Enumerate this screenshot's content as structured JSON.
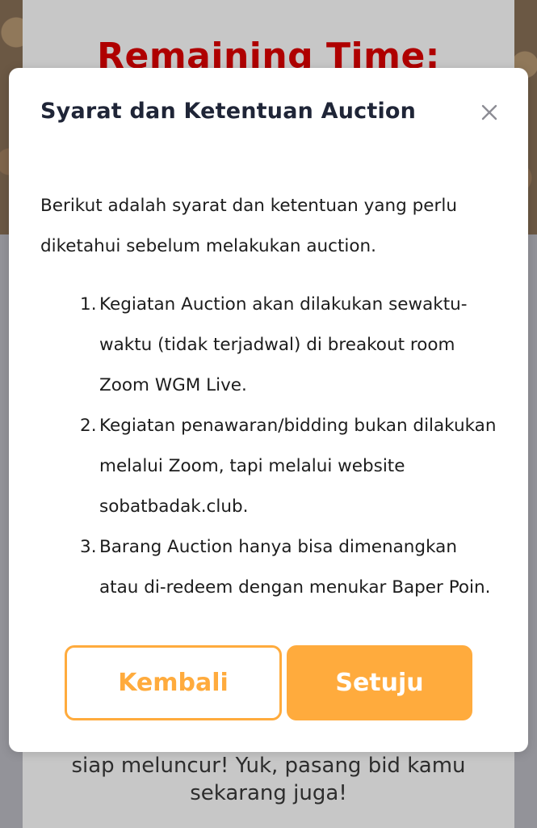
{
  "background": {
    "remaining_time_label": "Remaining Time:",
    "footer_text": "siap meluncur! Yuk, pasang bid kamu sekarang juga!"
  },
  "modal": {
    "title": "Syarat dan Ketentuan Auction",
    "close_icon": "close-icon",
    "intro": "Berikut adalah syarat dan ketentuan yang perlu diketahui sebelum melakukan auction.",
    "terms": [
      "Kegiatan Auction akan dilakukan sewaktu-waktu (tidak terjadwal) di breakout room Zoom WGM Live.",
      "Kegiatan penawaran/bidding bukan dilakukan melalui Zoom, tapi melalui website sobatbadak.club.",
      "Barang Auction hanya bisa dimenangkan atau di-redeem dengan menukar Baper Poin."
    ],
    "back_label": "Kembali",
    "agree_label": "Setuju"
  },
  "colors": {
    "accent": "#ffab3d",
    "title_text": "#1f2537",
    "remaining_red": "#e00000"
  }
}
